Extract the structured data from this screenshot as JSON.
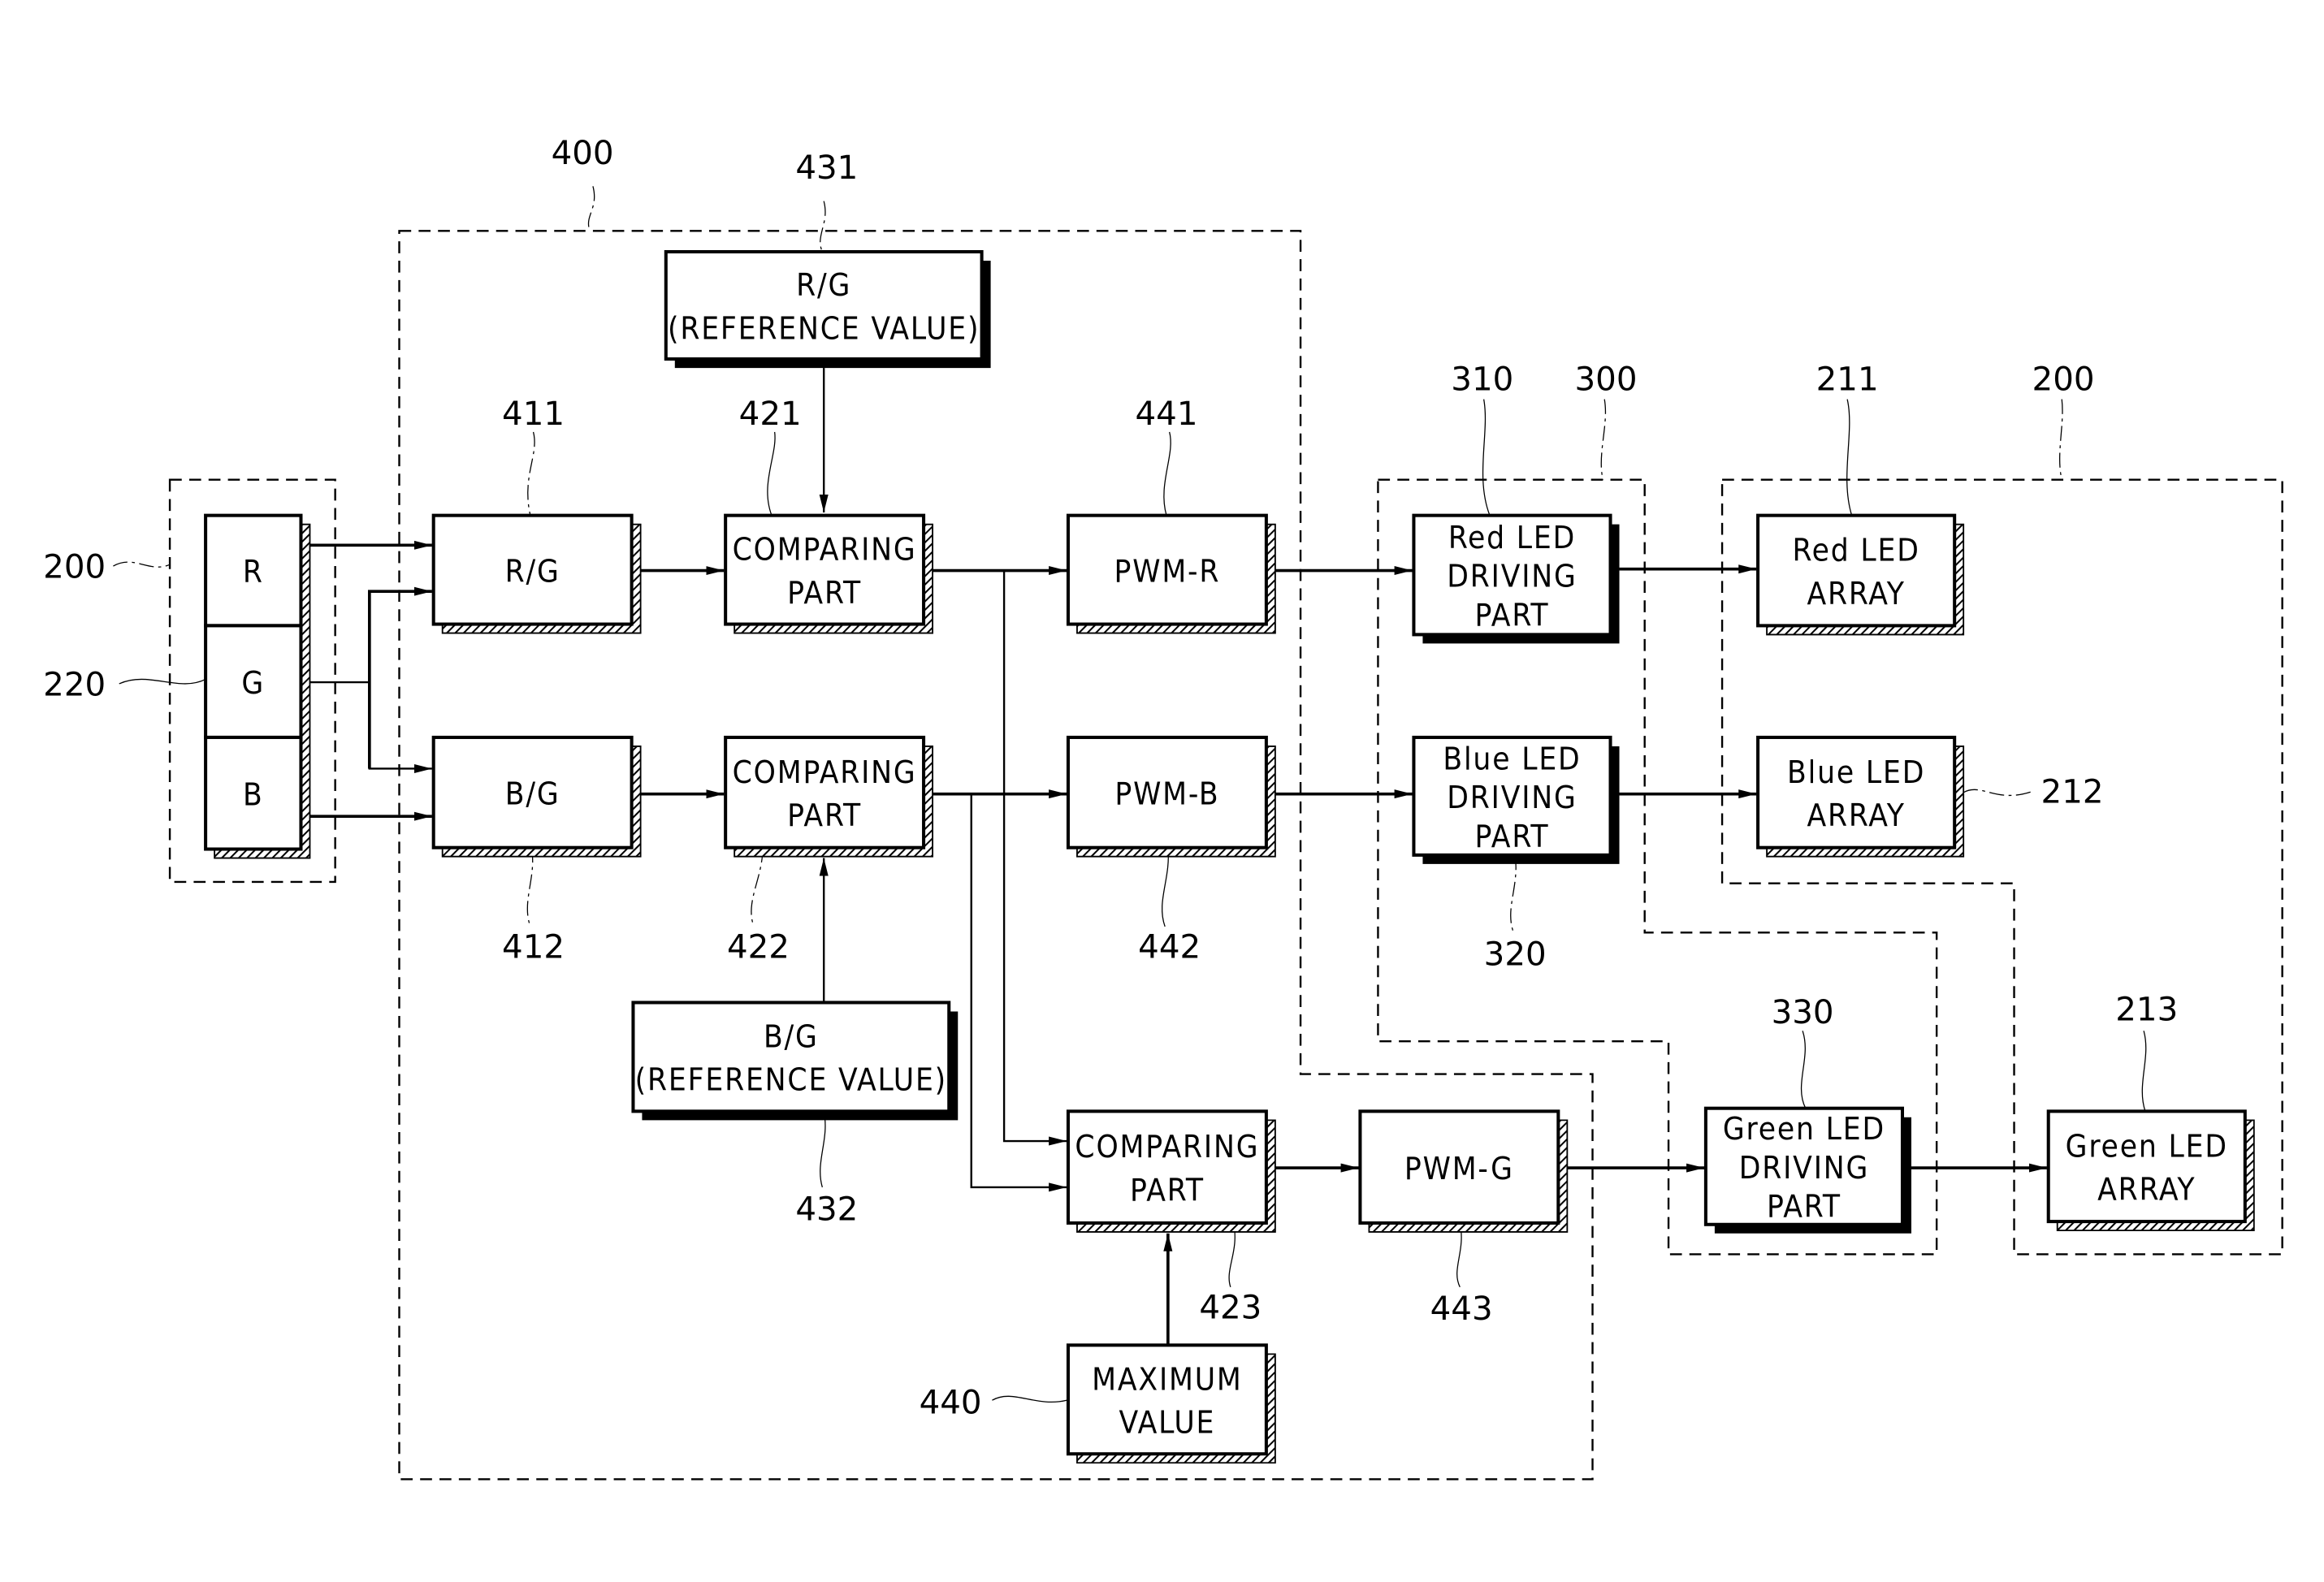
{
  "figure": {
    "type": "block-diagram",
    "groups": [
      {
        "id": "400",
        "ref": "400"
      },
      {
        "id": "200-input",
        "ref": "200"
      },
      {
        "id": "300",
        "ref": "300"
      },
      {
        "id": "200-output",
        "ref": "200"
      }
    ],
    "blocks": {
      "rgb_r": {
        "lines": [
          "R"
        ]
      },
      "rgb_g": {
        "lines": [
          "G"
        ]
      },
      "rgb_b": {
        "lines": [
          "B"
        ]
      },
      "rg_ref": {
        "ref": "431",
        "lines": [
          "R/G",
          "(REFERENCE VALUE)"
        ]
      },
      "rg": {
        "ref": "411",
        "lines": [
          "R/G"
        ]
      },
      "comp_r": {
        "ref": "421",
        "lines": [
          "COMPARING",
          "PART"
        ]
      },
      "pwm_r": {
        "ref": "441",
        "lines": [
          "PWM-R"
        ]
      },
      "bg": {
        "ref": "412",
        "lines": [
          "B/G"
        ]
      },
      "comp_b": {
        "ref": "422",
        "lines": [
          "COMPARING",
          "PART"
        ]
      },
      "pwm_b": {
        "ref": "442",
        "lines": [
          "PWM-B"
        ]
      },
      "bg_ref": {
        "ref": "432",
        "lines": [
          "B/G",
          "(REFERENCE VALUE)"
        ]
      },
      "comp_g": {
        "ref": "423",
        "lines": [
          "COMPARING",
          "PART"
        ]
      },
      "pwm_g": {
        "ref": "443",
        "lines": [
          "PWM-G"
        ]
      },
      "max": {
        "ref": "440",
        "lines": [
          "MAXIMUM",
          "VALUE"
        ]
      },
      "red_drv": {
        "ref": "310",
        "lines": [
          "Red LED",
          "DRIVING",
          "PART"
        ]
      },
      "blue_drv": {
        "ref": "320",
        "lines": [
          "Blue LED",
          "DRIVING",
          "PART"
        ]
      },
      "green_drv": {
        "ref": "330",
        "lines": [
          "Green LED",
          "DRIVING",
          "PART"
        ]
      },
      "red_arr": {
        "ref": "211",
        "lines": [
          "Red LED",
          "ARRAY"
        ]
      },
      "blue_arr": {
        "ref": "212",
        "lines": [
          "Blue LED",
          "ARRAY"
        ]
      },
      "green_arr": {
        "ref": "213",
        "lines": [
          "Green LED",
          "ARRAY"
        ]
      }
    },
    "refs": {
      "r400": "400",
      "r431": "431",
      "r411": "411",
      "r421": "421",
      "r441": "441",
      "r310": "310",
      "r300": "300",
      "r211": "211",
      "r200_right": "200",
      "r200_left": "200",
      "r220": "220",
      "r412": "412",
      "r422": "422",
      "r442": "442",
      "r320": "320",
      "r212": "212",
      "r432": "432",
      "r330": "330",
      "r213": "213",
      "r423": "423",
      "r443": "443",
      "r440": "440"
    },
    "connections": [
      [
        "rgb_r",
        "rg"
      ],
      [
        "rgb_g",
        "rg"
      ],
      [
        "rgb_g",
        "bg"
      ],
      [
        "rgb_b",
        "bg"
      ],
      [
        "rg",
        "comp_r"
      ],
      [
        "rg_ref",
        "comp_r"
      ],
      [
        "comp_r",
        "pwm_r"
      ],
      [
        "comp_r",
        "comp_g"
      ],
      [
        "bg",
        "comp_b"
      ],
      [
        "bg_ref",
        "comp_b"
      ],
      [
        "comp_b",
        "pwm_b"
      ],
      [
        "comp_b",
        "comp_g"
      ],
      [
        "max",
        "comp_g"
      ],
      [
        "comp_g",
        "pwm_g"
      ],
      [
        "pwm_r",
        "red_drv"
      ],
      [
        "pwm_b",
        "blue_drv"
      ],
      [
        "pwm_g",
        "green_drv"
      ],
      [
        "red_drv",
        "red_arr"
      ],
      [
        "blue_drv",
        "blue_arr"
      ],
      [
        "green_drv",
        "green_arr"
      ]
    ]
  }
}
